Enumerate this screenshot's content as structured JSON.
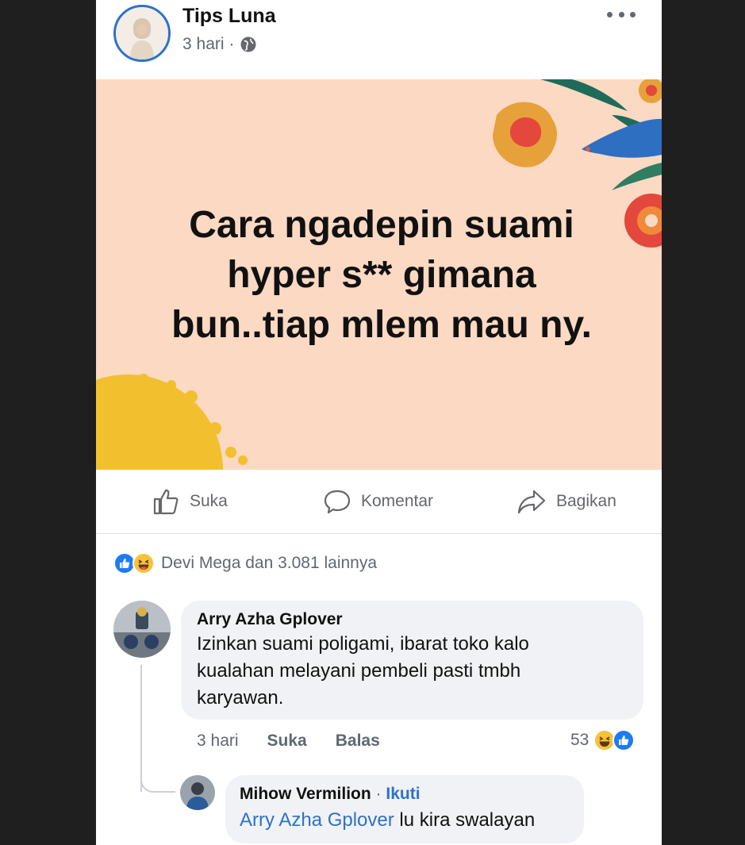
{
  "post": {
    "author": "Tips Luna",
    "time": "3 hari",
    "separator": "·",
    "privacy_icon": "globe-icon",
    "more_icon": "more-options-icon",
    "banner": {
      "background": "#fbd9c2",
      "lines": [
        "Cara ngadepin suami",
        "hyper s**  gimana",
        "bun..tiap mlem mau ny."
      ]
    }
  },
  "actions": {
    "like": {
      "label": "Suka",
      "icon": "thumbs-up-icon"
    },
    "comment": {
      "label": "Komentar",
      "icon": "comment-icon"
    },
    "share": {
      "label": "Bagikan",
      "icon": "share-icon"
    }
  },
  "reactions": {
    "icons": [
      "like-reaction-icon",
      "haha-reaction-icon"
    ],
    "summary": "Devi Mega dan 3.081 lainnya"
  },
  "comments": [
    {
      "name": "Arry Azha Gplover",
      "lines": [
        "Izinkan suami poligami, ibarat toko kalo",
        "kualahan melayani pembeli pasti tmbh",
        "karyawan."
      ],
      "time": "3 hari",
      "like_label": "Suka",
      "reply_label": "Balas",
      "reaction_count": "53",
      "reply": {
        "name": "Mihow Vermilion",
        "separator": "·",
        "follow_label": "Ikuti",
        "mention": "Arry Azha Gplover",
        "text": "lu kira swalayan"
      }
    }
  ],
  "colors": {
    "accent": "#2d72c8",
    "muted": "#606770",
    "bubble": "#f0f2f5"
  }
}
